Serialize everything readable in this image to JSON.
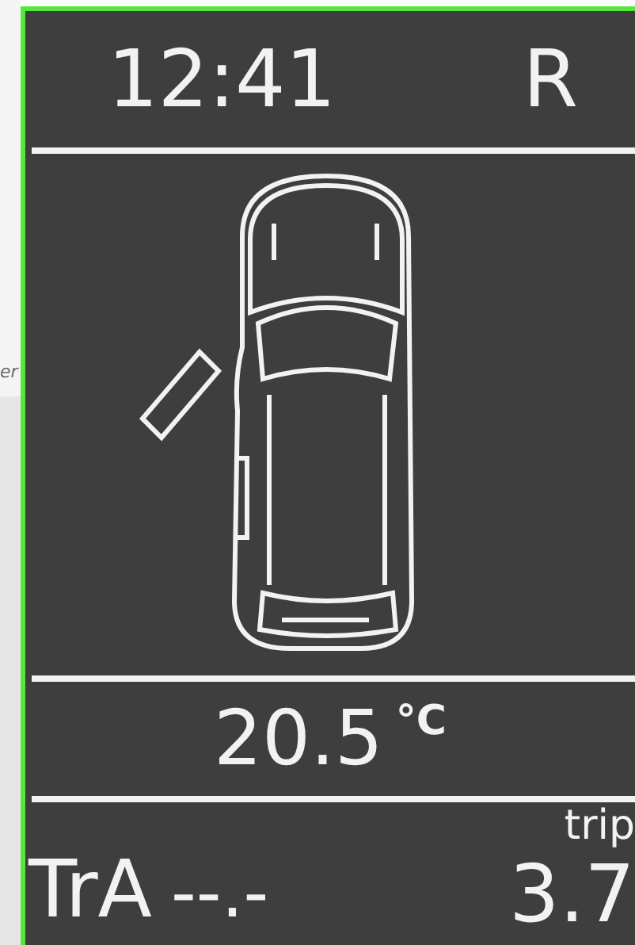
{
  "backdrop_text": "er",
  "header": {
    "time": "12:41",
    "gear": "R"
  },
  "car": {
    "front_left_door_open": true
  },
  "temperature": {
    "value": "20.5",
    "unit": "°C"
  },
  "footer": {
    "label": "TrA",
    "reading": "--.-",
    "trip_label": "trip",
    "trip_value": "3.7"
  }
}
